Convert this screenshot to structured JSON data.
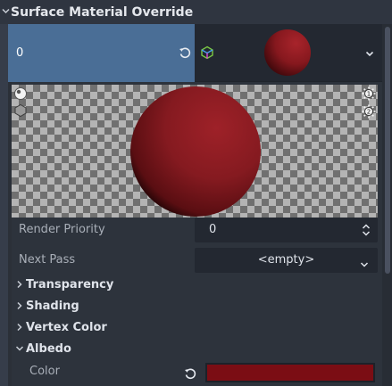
{
  "section": {
    "title": "Surface Material Override"
  },
  "slot": {
    "index_value": "0",
    "material_preview_color": "#7a1419"
  },
  "preview_panel": {
    "sphere_color": "#8a1a20",
    "checker_light": "#b4b4b4",
    "checker_dark": "#707070"
  },
  "properties": {
    "render_priority": {
      "label": "Render Priority",
      "value": "0"
    },
    "next_pass": {
      "label": "Next Pass",
      "value": "<empty>"
    }
  },
  "groups": [
    {
      "label": "Transparency",
      "expanded": false
    },
    {
      "label": "Shading",
      "expanded": false
    },
    {
      "label": "Vertex Color",
      "expanded": false
    },
    {
      "label": "Albedo",
      "expanded": true
    }
  ],
  "albedo": {
    "color_label": "Color",
    "color_value": "#7b0d14"
  },
  "colors": {
    "accent": "#4a6e96",
    "panel_bg": "#2d333c",
    "editor_bg": "#232831"
  }
}
